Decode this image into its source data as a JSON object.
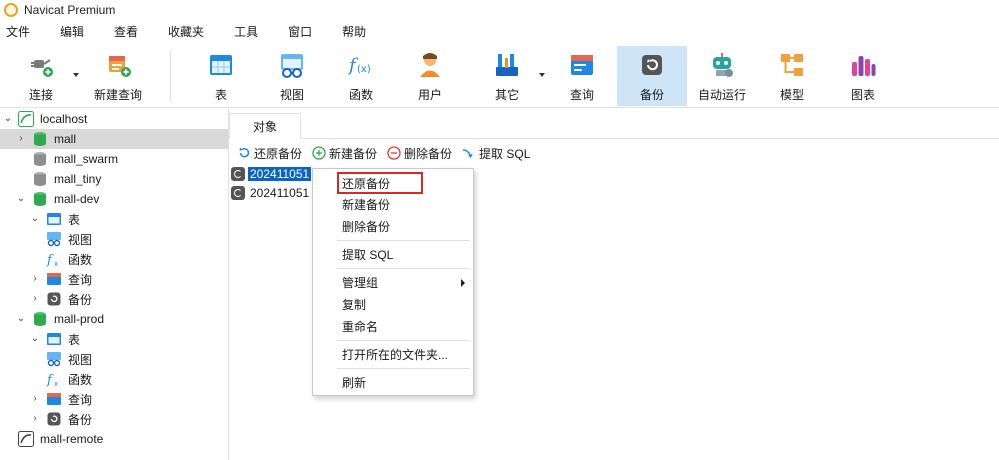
{
  "window": {
    "title": "Navicat Premium"
  },
  "menubar": [
    "文件",
    "编辑",
    "查看",
    "收藏夹",
    "工具",
    "窗口",
    "帮助"
  ],
  "toolbar": {
    "connect": "连接",
    "new_query": "新建查询",
    "table": "表",
    "view": "视图",
    "function": "函数",
    "user": "用户",
    "other": "其它",
    "query": "查询",
    "backup": "备份",
    "automation": "自动运行",
    "model": "模型",
    "chart": "图表"
  },
  "tree": {
    "localhost": "localhost",
    "mall": "mall",
    "mall_swarm": "mall_swarm",
    "mall_tiny": "mall_tiny",
    "mall_dev": "mall-dev",
    "dev_table": "表",
    "dev_view": "视图",
    "dev_function": "函数",
    "dev_query": "查询",
    "dev_backup": "备份",
    "mall_prod": "mall-prod",
    "prod_table": "表",
    "prod_view": "视图",
    "prod_function": "函数",
    "prod_query": "查询",
    "prod_backup": "备份",
    "mall_remote": "mall-remote"
  },
  "tab": {
    "objects": "对象"
  },
  "object_toolbar": {
    "restore": "还原备份",
    "new": "新建备份",
    "delete": "删除备份",
    "extract": "提取 SQL"
  },
  "files": [
    "202411051",
    "202411051"
  ],
  "context_menu": {
    "restore": "还原备份",
    "new": "新建备份",
    "delete": "删除备份",
    "extract": "提取 SQL",
    "manage_group": "管理组",
    "copy": "复制",
    "rename": "重命名",
    "open_folder": "打开所在的文件夹...",
    "refresh": "刷新"
  },
  "colors": {
    "accent": "#0a64c8",
    "active_toolbar": "#cde5f7",
    "highlight_box": "#d42a2a",
    "db_green": "#2fa84f"
  }
}
